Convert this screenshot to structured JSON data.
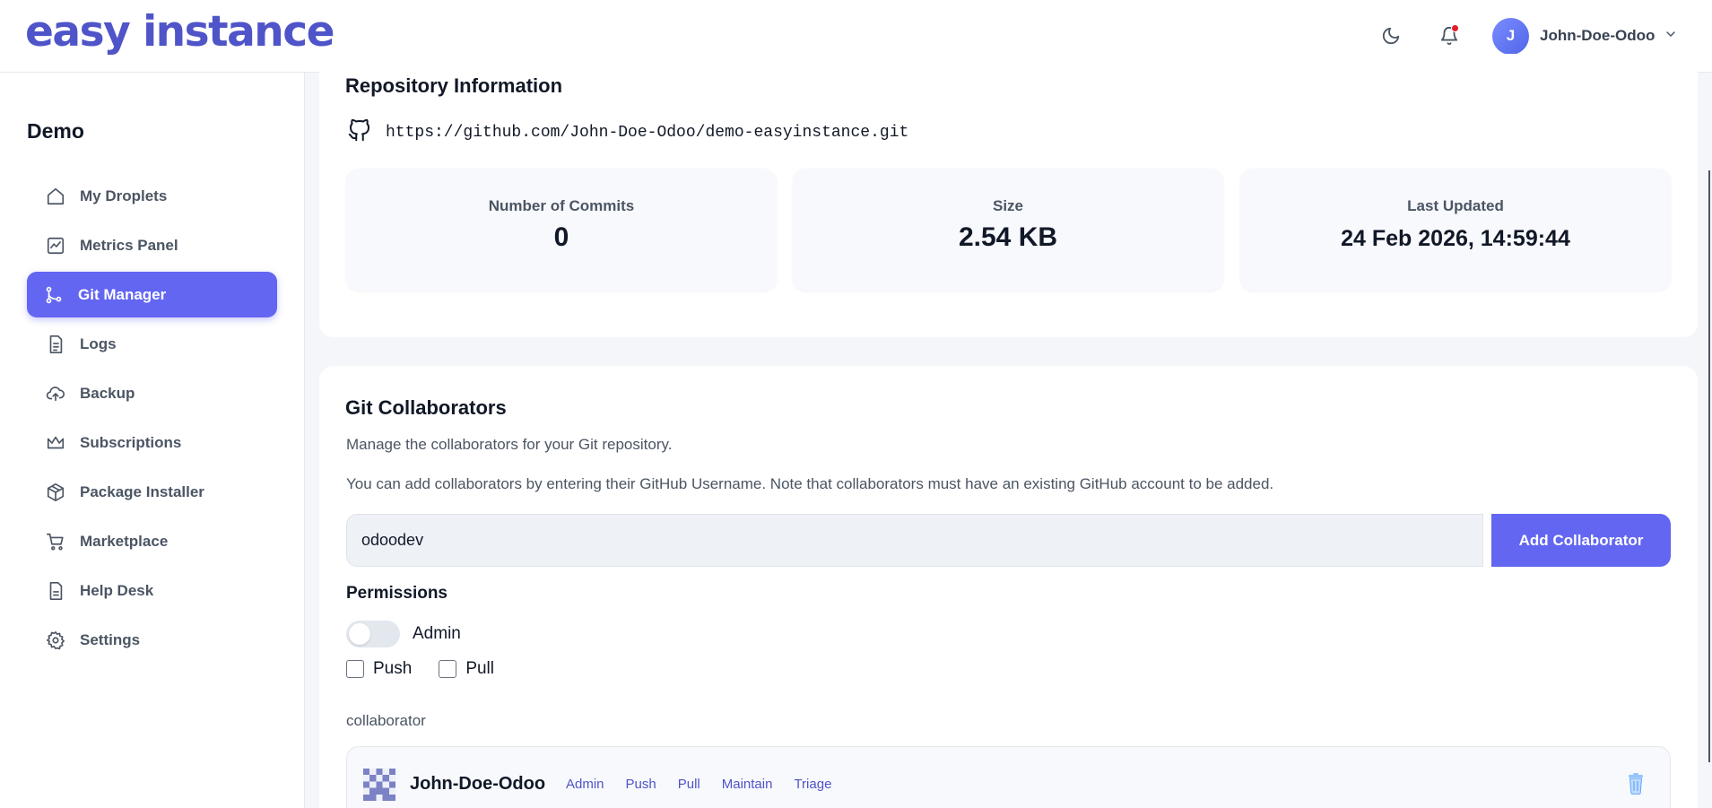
{
  "header": {
    "logo": "easy instance",
    "user_initial": "J",
    "user_name": "John-Doe-Odoo"
  },
  "sidebar": {
    "project": "Demo",
    "items": [
      {
        "label": "My Droplets",
        "icon": "home-icon"
      },
      {
        "label": "Metrics Panel",
        "icon": "chart-icon"
      },
      {
        "label": "Git Manager",
        "icon": "git-branch-icon",
        "active": true
      },
      {
        "label": "Logs",
        "icon": "file-text-icon"
      },
      {
        "label": "Backup",
        "icon": "cloud-upload-icon"
      },
      {
        "label": "Subscriptions",
        "icon": "crown-icon"
      },
      {
        "label": "Package Installer",
        "icon": "package-icon"
      },
      {
        "label": "Marketplace",
        "icon": "cart-icon"
      },
      {
        "label": "Help Desk",
        "icon": "document-icon"
      },
      {
        "label": "Settings",
        "icon": "gear-icon"
      }
    ]
  },
  "repo": {
    "title": "Repository Information",
    "url": "https://github.com/John-Doe-Odoo/demo-easyinstance.git",
    "stats": [
      {
        "label": "Number of Commits",
        "value": "0"
      },
      {
        "label": "Size",
        "value": "2.54 KB"
      },
      {
        "label": "Last Updated",
        "value": "24 Feb 2026, 14:59:44"
      }
    ]
  },
  "collab": {
    "title": "Git Collaborators",
    "desc1": "Manage the collaborators for your Git repository.",
    "desc2": "You can add collaborators by entering their GitHub Username. Note that collaborators must have an existing GitHub account to be added.",
    "input_value": "odoodev",
    "add_button": "Add Collaborator",
    "permissions_title": "Permissions",
    "admin_label": "Admin",
    "admin_on": false,
    "push_label": "Push",
    "pull_label": "Pull",
    "list_label": "collaborator",
    "members": [
      {
        "name": "John-Doe-Odoo",
        "tags": [
          "Admin",
          "Push",
          "Pull",
          "Maintain",
          "Triage"
        ]
      }
    ]
  },
  "colors": {
    "accent": "#6366f1",
    "logo": "#4f54c8",
    "notification": "#e11d2a"
  }
}
